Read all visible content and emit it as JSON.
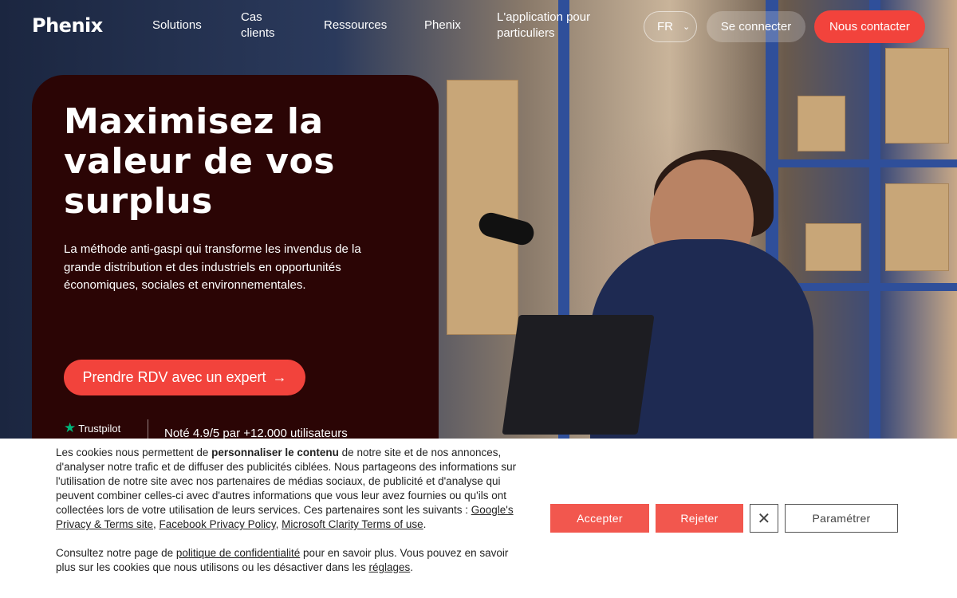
{
  "nav": {
    "logo": "Phenix",
    "links": [
      "Solutions",
      "Cas clients",
      "Ressources",
      "Phenix",
      "L'application pour particuliers"
    ],
    "lang": "FR",
    "login": "Se connecter",
    "contact": "Nous contacter"
  },
  "hero": {
    "headline": "Maximisez la valeur de vos surplus",
    "subtitle": "La méthode anti-gaspi qui transforme les invendus de la grande distribution et des industriels en opportunités économiques, sociales et environnementales.",
    "cta": "Prendre RDV avec un expert",
    "cta_arrow": "→",
    "trustpilot": "Trustpilot",
    "rating": "Noté 4.9/5 par +12.000 utilisateurs"
  },
  "cookie": {
    "p1_a": "Les cookies nous permettent de ",
    "p1_bold": "personnaliser le contenu",
    "p1_b": " de notre site et de nos annonces, d'analyser notre trafic et de diffuser des publicités ciblées. Nous partageons des informations sur l'utilisation de notre site avec nos partenaires de médias sociaux, de publicité et d'analyse qui peuvent combiner celles-ci avec d'autres informations que vous leur avez fournies ou qu'ils ont collectées lors de votre utilisation de leurs services. Ces partenaires sont les suivants : ",
    "link_google": "Google's Privacy & Terms site",
    "sep1": ", ",
    "link_facebook": "Facebook Privacy Policy",
    "sep2": ", ",
    "link_clarity": "Microsoft Clarity Terms of use",
    "p1_end": ".",
    "p2_a": "Consultez notre page de ",
    "link_policy": "politique de confidentialité",
    "p2_b": " pour en savoir plus. Vous pouvez en savoir plus sur les cookies que nous utilisons ou les désactiver dans les ",
    "link_settings": "réglages",
    "p2_end": ".",
    "accept": "Accepter",
    "reject": "Rejeter",
    "close": "✕",
    "settings": "Paramétrer"
  }
}
